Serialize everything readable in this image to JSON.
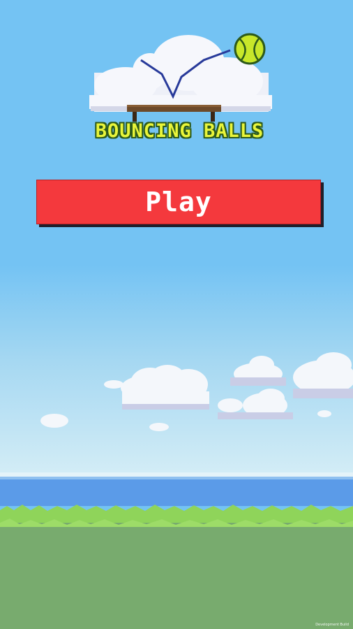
{
  "game": {
    "title": "BOUNCING BALLS",
    "play_label": "Play",
    "build_label": "Development Build"
  },
  "colors": {
    "sky": "#74c3f3",
    "play_button": "#f4393d",
    "title_text": "#e9f53a",
    "sea": "#5b9be8",
    "grass": "#78ab6e"
  },
  "icons": {
    "ball": "tennis-ball-icon",
    "trampoline": "trampoline-icon",
    "cloud": "cloud-icon"
  }
}
